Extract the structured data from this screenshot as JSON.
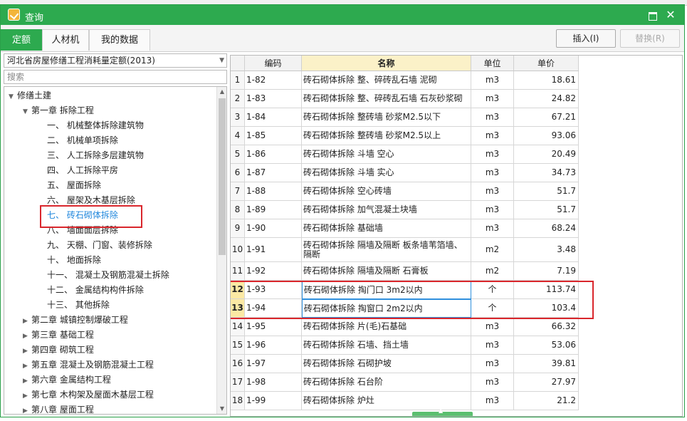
{
  "window": {
    "title": "查询"
  },
  "tabs": [
    {
      "label": "定额",
      "active": true
    },
    {
      "label": "人材机",
      "active": false
    },
    {
      "label": "我的数据",
      "active": false
    }
  ],
  "toolbar": {
    "insert_label": "插入(I)",
    "replace_label": "替换(R)"
  },
  "left_panel": {
    "library_select": "河北省房屋修缮工程消耗量定额(2013)",
    "search_placeholder": "搜索",
    "tree": [
      {
        "label": "修缮土建",
        "level": 0,
        "toggle": "▼"
      },
      {
        "label": "第一章 拆除工程",
        "level": 1,
        "toggle": "▼"
      },
      {
        "label": "一、 机械整体拆除建筑物",
        "level": 2,
        "toggle": ""
      },
      {
        "label": "二、 机械单项拆除",
        "level": 2,
        "toggle": ""
      },
      {
        "label": "三、 人工拆除多层建筑物",
        "level": 2,
        "toggle": ""
      },
      {
        "label": "四、 人工拆除平房",
        "level": 2,
        "toggle": ""
      },
      {
        "label": "五、 屋面拆除",
        "level": 2,
        "toggle": ""
      },
      {
        "label": "六、 屋架及木基层拆除",
        "level": 2,
        "toggle": ""
      },
      {
        "label": "七、 砖石砌体拆除",
        "level": 2,
        "toggle": "",
        "selected": true
      },
      {
        "label": "八、 墙面面层拆除",
        "level": 2,
        "toggle": ""
      },
      {
        "label": "九、 天棚、门窗、装修拆除",
        "level": 2,
        "toggle": ""
      },
      {
        "label": "十、 地面拆除",
        "level": 2,
        "toggle": ""
      },
      {
        "label": "十一、 混凝土及钢筋混凝土拆除",
        "level": 2,
        "toggle": ""
      },
      {
        "label": "十二、 金属结构构件拆除",
        "level": 2,
        "toggle": ""
      },
      {
        "label": "十三、 其他拆除",
        "level": 2,
        "toggle": ""
      },
      {
        "label": "第二章 城镇控制爆破工程",
        "level": 1,
        "toggle": "▶"
      },
      {
        "label": "第三章 基础工程",
        "level": 1,
        "toggle": "▶"
      },
      {
        "label": "第四章 砌筑工程",
        "level": 1,
        "toggle": "▶"
      },
      {
        "label": "第五章 混凝土及钢筋混凝土工程",
        "level": 1,
        "toggle": "▶"
      },
      {
        "label": "第六章 金属结构工程",
        "level": 1,
        "toggle": "▶"
      },
      {
        "label": "第七章 木构架及屋面木基层工程",
        "level": 1,
        "toggle": "▶"
      },
      {
        "label": "第八章 屋面工程",
        "level": 1,
        "toggle": "▶"
      }
    ]
  },
  "table": {
    "headers": {
      "code": "编码",
      "name": "名称",
      "unit": "单位",
      "price": "单价"
    },
    "rows": [
      {
        "no": "1",
        "code": "1-82",
        "name": "砖石砌体拆除 整、碎砖乱石墙 泥砌",
        "unit": "m3",
        "price": "18.61"
      },
      {
        "no": "2",
        "code": "1-83",
        "name": "砖石砌体拆除 整、碎砖乱石墙 石灰砂浆砌",
        "unit": "m3",
        "price": "24.82"
      },
      {
        "no": "3",
        "code": "1-84",
        "name": "砖石砌体拆除 整砖墙 砂浆M2.5以下",
        "unit": "m3",
        "price": "67.21"
      },
      {
        "no": "4",
        "code": "1-85",
        "name": "砖石砌体拆除 整砖墙 砂浆M2.5以上",
        "unit": "m3",
        "price": "93.06"
      },
      {
        "no": "5",
        "code": "1-86",
        "name": "砖石砌体拆除 斗墙 空心",
        "unit": "m3",
        "price": "20.49"
      },
      {
        "no": "6",
        "code": "1-87",
        "name": "砖石砌体拆除 斗墙 实心",
        "unit": "m3",
        "price": "34.73"
      },
      {
        "no": "7",
        "code": "1-88",
        "name": "砖石砌体拆除 空心砖墙",
        "unit": "m3",
        "price": "51.7"
      },
      {
        "no": "8",
        "code": "1-89",
        "name": "砖石砌体拆除 加气混凝土块墙",
        "unit": "m3",
        "price": "51.7"
      },
      {
        "no": "9",
        "code": "1-90",
        "name": "砖石砌体拆除 基础墙",
        "unit": "m3",
        "price": "68.24"
      },
      {
        "no": "10",
        "code": "1-91",
        "name": "砖石砌体拆除 隔墙及隔断 板条墙苇箔墙、隔断",
        "unit": "m2",
        "price": "3.48"
      },
      {
        "no": "11",
        "code": "1-92",
        "name": "砖石砌体拆除 隔墙及隔断 石膏板",
        "unit": "m2",
        "price": "7.19"
      },
      {
        "no": "12",
        "code": "1-93",
        "name": "砖石砌体拆除 掏门口 3m2以内",
        "unit": "个",
        "price": "113.74",
        "highlight": true
      },
      {
        "no": "13",
        "code": "1-94",
        "name": "砖石砌体拆除 掏窗口 2m2以内",
        "unit": "个",
        "price": "103.4",
        "highlight": true
      },
      {
        "no": "14",
        "code": "1-95",
        "name": "砖石砌体拆除 片(毛)石基础",
        "unit": "m3",
        "price": "66.32"
      },
      {
        "no": "15",
        "code": "1-96",
        "name": "砖石砌体拆除 石墙、挡土墙",
        "unit": "m3",
        "price": "53.06"
      },
      {
        "no": "16",
        "code": "1-97",
        "name": "砖石砌体拆除 石砌护坡",
        "unit": "m3",
        "price": "39.81"
      },
      {
        "no": "17",
        "code": "1-98",
        "name": "砖石砌体拆除 石台阶",
        "unit": "m3",
        "price": "27.97"
      },
      {
        "no": "18",
        "code": "1-99",
        "name": "砖石砌体拆除 炉灶",
        "unit": "m3",
        "price": "21.2"
      }
    ]
  },
  "colors": {
    "titlebar": "#2daa4f",
    "accent": "#2daa4f",
    "selected_text": "#2288dd",
    "annotation_red": "#d9262c",
    "highlight_row": "#fbe9a4"
  }
}
